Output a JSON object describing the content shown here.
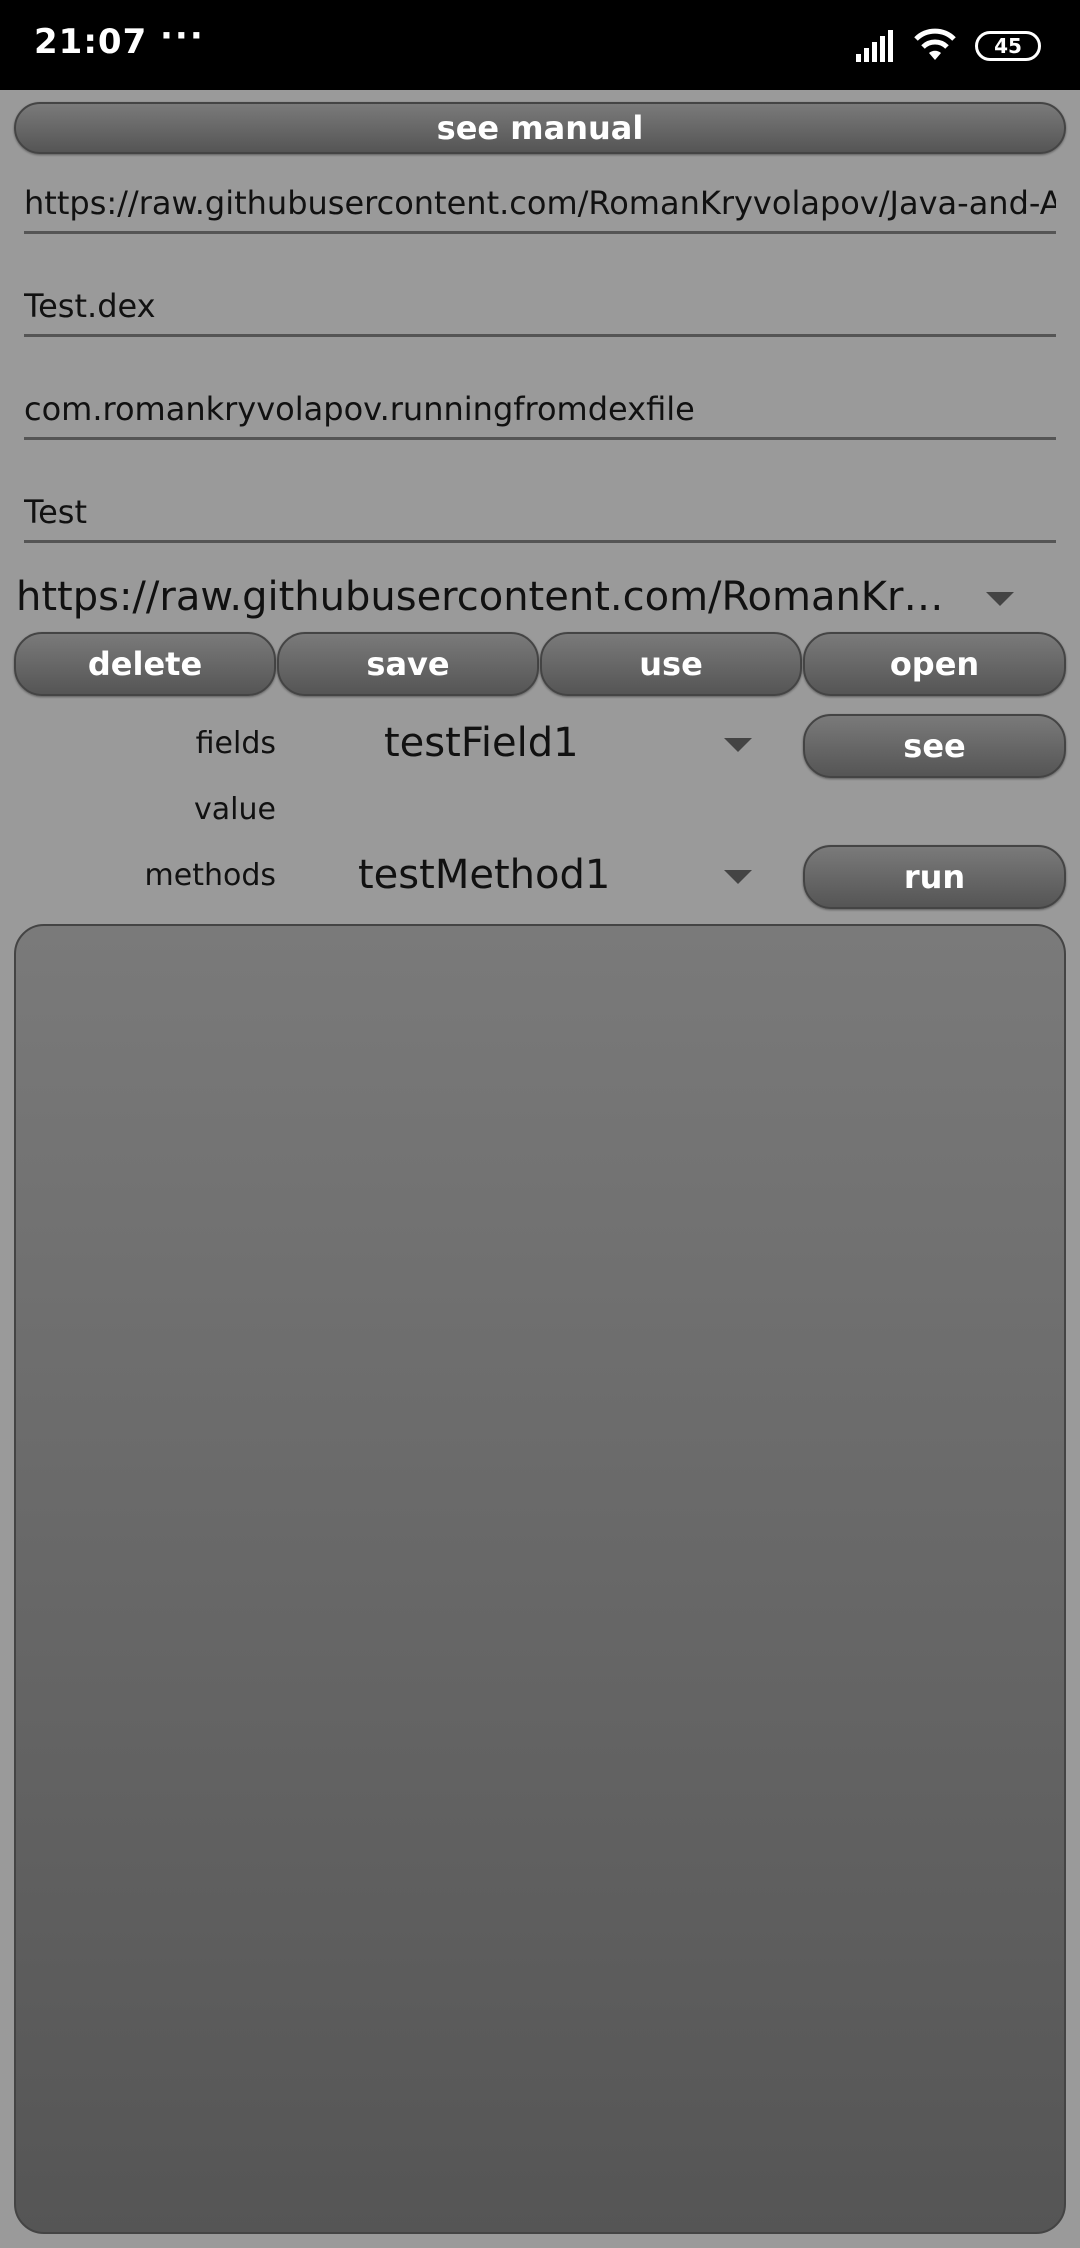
{
  "status_bar": {
    "time": "21:07",
    "dots": "···",
    "battery": "45"
  },
  "top_button": {
    "label": "see manual"
  },
  "fields": {
    "url": "https://raw.githubusercontent.com/RomanKryvolapov/Java-and-And",
    "file": "Test.dex",
    "package": "com.romankryvolapov.runningfromdexfile",
    "class": "Test"
  },
  "preset_spinner": {
    "value": "https://raw.githubusercontent.com/RomanKryvol..."
  },
  "action_buttons": {
    "delete": "delete",
    "save": "save",
    "use": "use",
    "open": "open"
  },
  "fields_row": {
    "label": "fields",
    "selected": "testField1",
    "button": "see"
  },
  "value_row": {
    "label": "value"
  },
  "methods_row": {
    "label": "methods",
    "selected": "testMethod1",
    "button": "run"
  },
  "colors": {
    "background": "#9a9a9a",
    "button_top": "#7a7a7a",
    "button_bottom": "#555555",
    "status_bar": "#000000"
  }
}
